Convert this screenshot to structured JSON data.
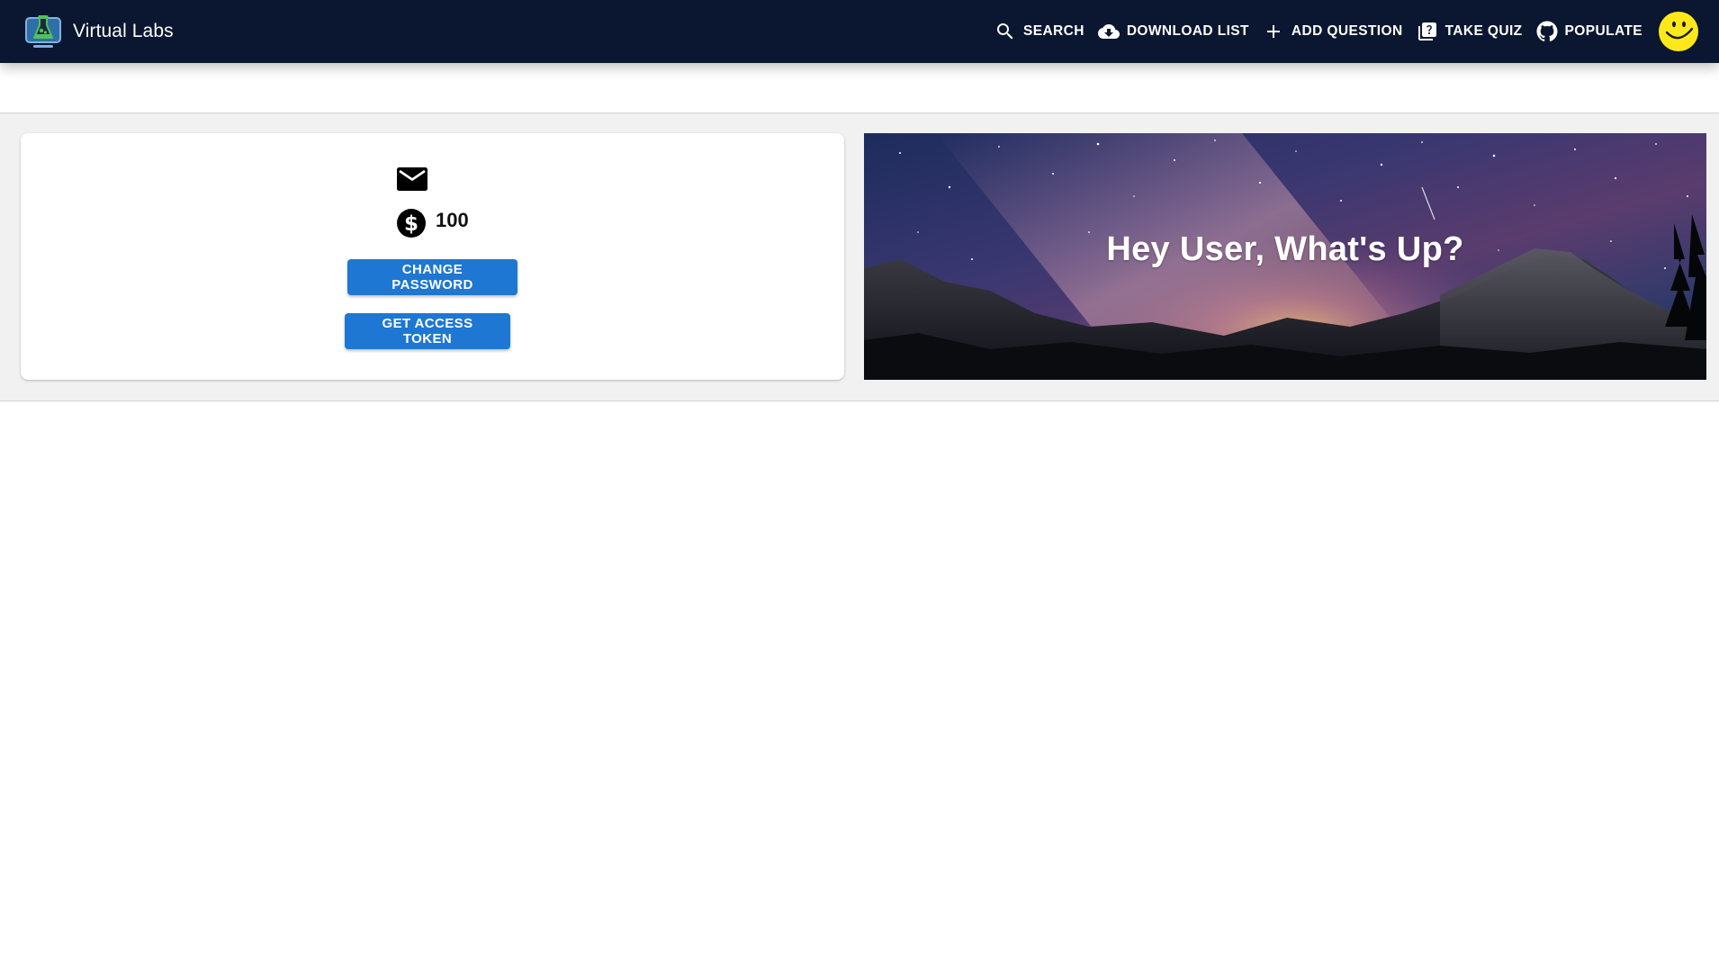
{
  "app": {
    "title": "Virtual Labs"
  },
  "nav": {
    "items": [
      {
        "label": "SEARCH",
        "icon": "search-icon"
      },
      {
        "label": "DOWNLOAD LIST",
        "icon": "cloud-download-icon"
      },
      {
        "label": "ADD QUESTION",
        "icon": "plus-icon"
      },
      {
        "label": "TAKE QUIZ",
        "icon": "quiz-icon"
      },
      {
        "label": "POPULATE",
        "icon": "github-icon"
      }
    ],
    "avatar_icon": "smiley-icon"
  },
  "profile": {
    "email_icon": "mail-icon",
    "coins_icon": "dollar-coin-icon",
    "coins": "100",
    "change_password_label": "CHANGE PASSWORD",
    "access_token_label": "GET ACCESS TOKEN"
  },
  "hero": {
    "greeting": "Hey User, What's Up?"
  },
  "colors": {
    "appbar": "#0b1730",
    "primary_button": "#1e77d2",
    "band_background": "#f1f1f1",
    "avatar": "#ffe81a"
  }
}
